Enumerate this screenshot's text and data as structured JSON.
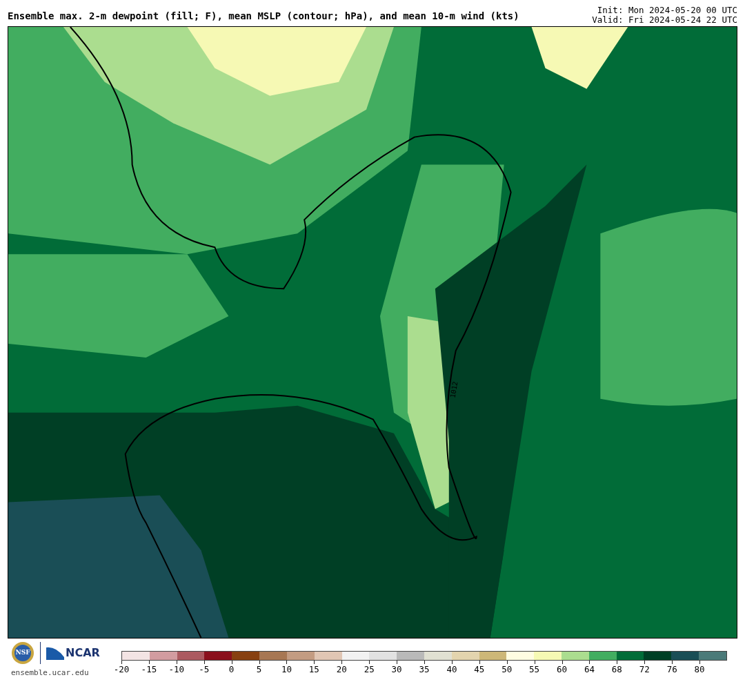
{
  "header": {
    "title": "Ensemble max. 2-m dewpoint (fill; F), mean MSLP (contour; hPa), and mean 10-m wind (kts)",
    "init": "Init: Mon 2024-05-20 00 UTC",
    "valid": "Valid: Fri 2024-05-24 22 UTC"
  },
  "map": {
    "contour_label": "1012"
  },
  "footer": {
    "nsf_logo": "NSF",
    "ncar_logo": "NCAR",
    "site": "ensemble.ucar.edu"
  },
  "colorbar": {
    "ticks": [
      "-20",
      "-15",
      "-10",
      "-5",
      "0",
      "5",
      "10",
      "15",
      "20",
      "25",
      "30",
      "35",
      "40",
      "45",
      "50",
      "55",
      "60",
      "64",
      "68",
      "72",
      "76",
      "80"
    ],
    "segments": [
      {
        "color": "#f3e4e4"
      },
      {
        "color": "#d29ca0"
      },
      {
        "color": "#ab5a60"
      },
      {
        "color": "#8a101c"
      },
      {
        "color": "#874011"
      },
      {
        "color": "#a77753"
      },
      {
        "color": "#c39c82"
      },
      {
        "color": "#e0c6b4"
      },
      {
        "color": "#f2f2f2"
      },
      {
        "color": "#e2e2e2"
      },
      {
        "color": "#b9b9b9"
      },
      {
        "color": "#e0e0d2"
      },
      {
        "color": "#e3d4ae"
      },
      {
        "color": "#cdb778"
      },
      {
        "color": "#fffce2"
      },
      {
        "color": "#f6f9b4"
      },
      {
        "color": "#abdd8f"
      },
      {
        "color": "#42ad60"
      },
      {
        "color": "#016c38"
      },
      {
        "color": "#003f25"
      },
      {
        "color": "#1a4e56"
      },
      {
        "color": "#4b7a79"
      }
    ]
  }
}
